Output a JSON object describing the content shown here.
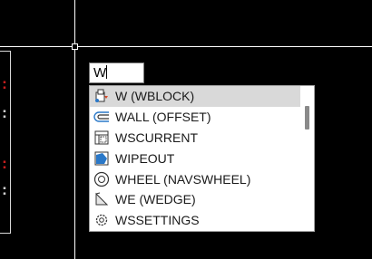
{
  "command_line": {
    "value": "W"
  },
  "autocomplete": {
    "items": [
      {
        "label": "W (WBLOCK)",
        "icon": "wblock-icon",
        "selected": true
      },
      {
        "label": "WALL (OFFSET)",
        "icon": "offset-icon",
        "selected": false
      },
      {
        "label": "WSCURRENT",
        "icon": "workspace-icon",
        "selected": false
      },
      {
        "label": "WIPEOUT",
        "icon": "wipeout-icon",
        "selected": false
      },
      {
        "label": "WHEEL (NAVSWHEEL)",
        "icon": "navswheel-icon",
        "selected": false
      },
      {
        "label": "WE (WEDGE)",
        "icon": "wedge-icon",
        "selected": false
      },
      {
        "label": "WSSETTINGS",
        "icon": "gear-icon",
        "selected": false
      }
    ]
  },
  "colors": {
    "canvas": "#000000",
    "crosshair": "#ffffff",
    "selected_row": "#d9d9d9",
    "icon_blue": "#2a78c8"
  }
}
